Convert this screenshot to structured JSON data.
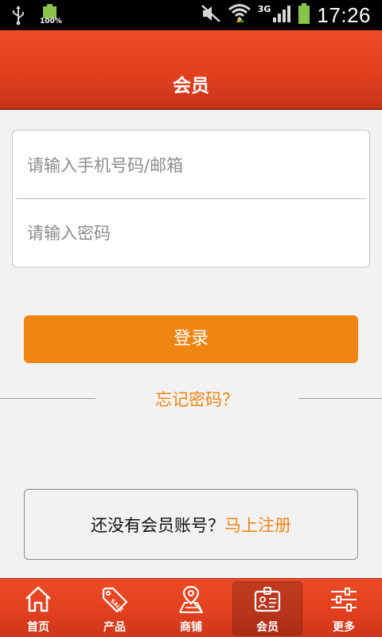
{
  "status_bar": {
    "battery_small_label": "100%",
    "network_label": "3G",
    "time": "17:26",
    "icons": [
      "usb-icon",
      "battery-icon",
      "mute-icon",
      "wifi-icon",
      "signal-icon",
      "battery-icon"
    ]
  },
  "header": {
    "title": "会员"
  },
  "login_form": {
    "phone_placeholder": "请输入手机号码/邮箱",
    "phone_value": "",
    "password_placeholder": "请输入密码",
    "password_value": ""
  },
  "login_button": {
    "label": "登录"
  },
  "forgot": {
    "label": "忘记密码？"
  },
  "register": {
    "prompt": "还没有会员账号？",
    "link": "马上注册"
  },
  "tabbar": {
    "items": [
      {
        "label": "首页",
        "icon": "home-icon"
      },
      {
        "label": "产品",
        "icon": "sale-tag-icon"
      },
      {
        "label": "商铺",
        "icon": "map-pin-icon"
      },
      {
        "label": "会员",
        "icon": "member-card-icon",
        "active": true
      },
      {
        "label": "更多",
        "icon": "sliders-icon"
      }
    ]
  },
  "colors": {
    "accent": "#f08514",
    "header": "#e2401f",
    "status_bar": "#000000"
  }
}
